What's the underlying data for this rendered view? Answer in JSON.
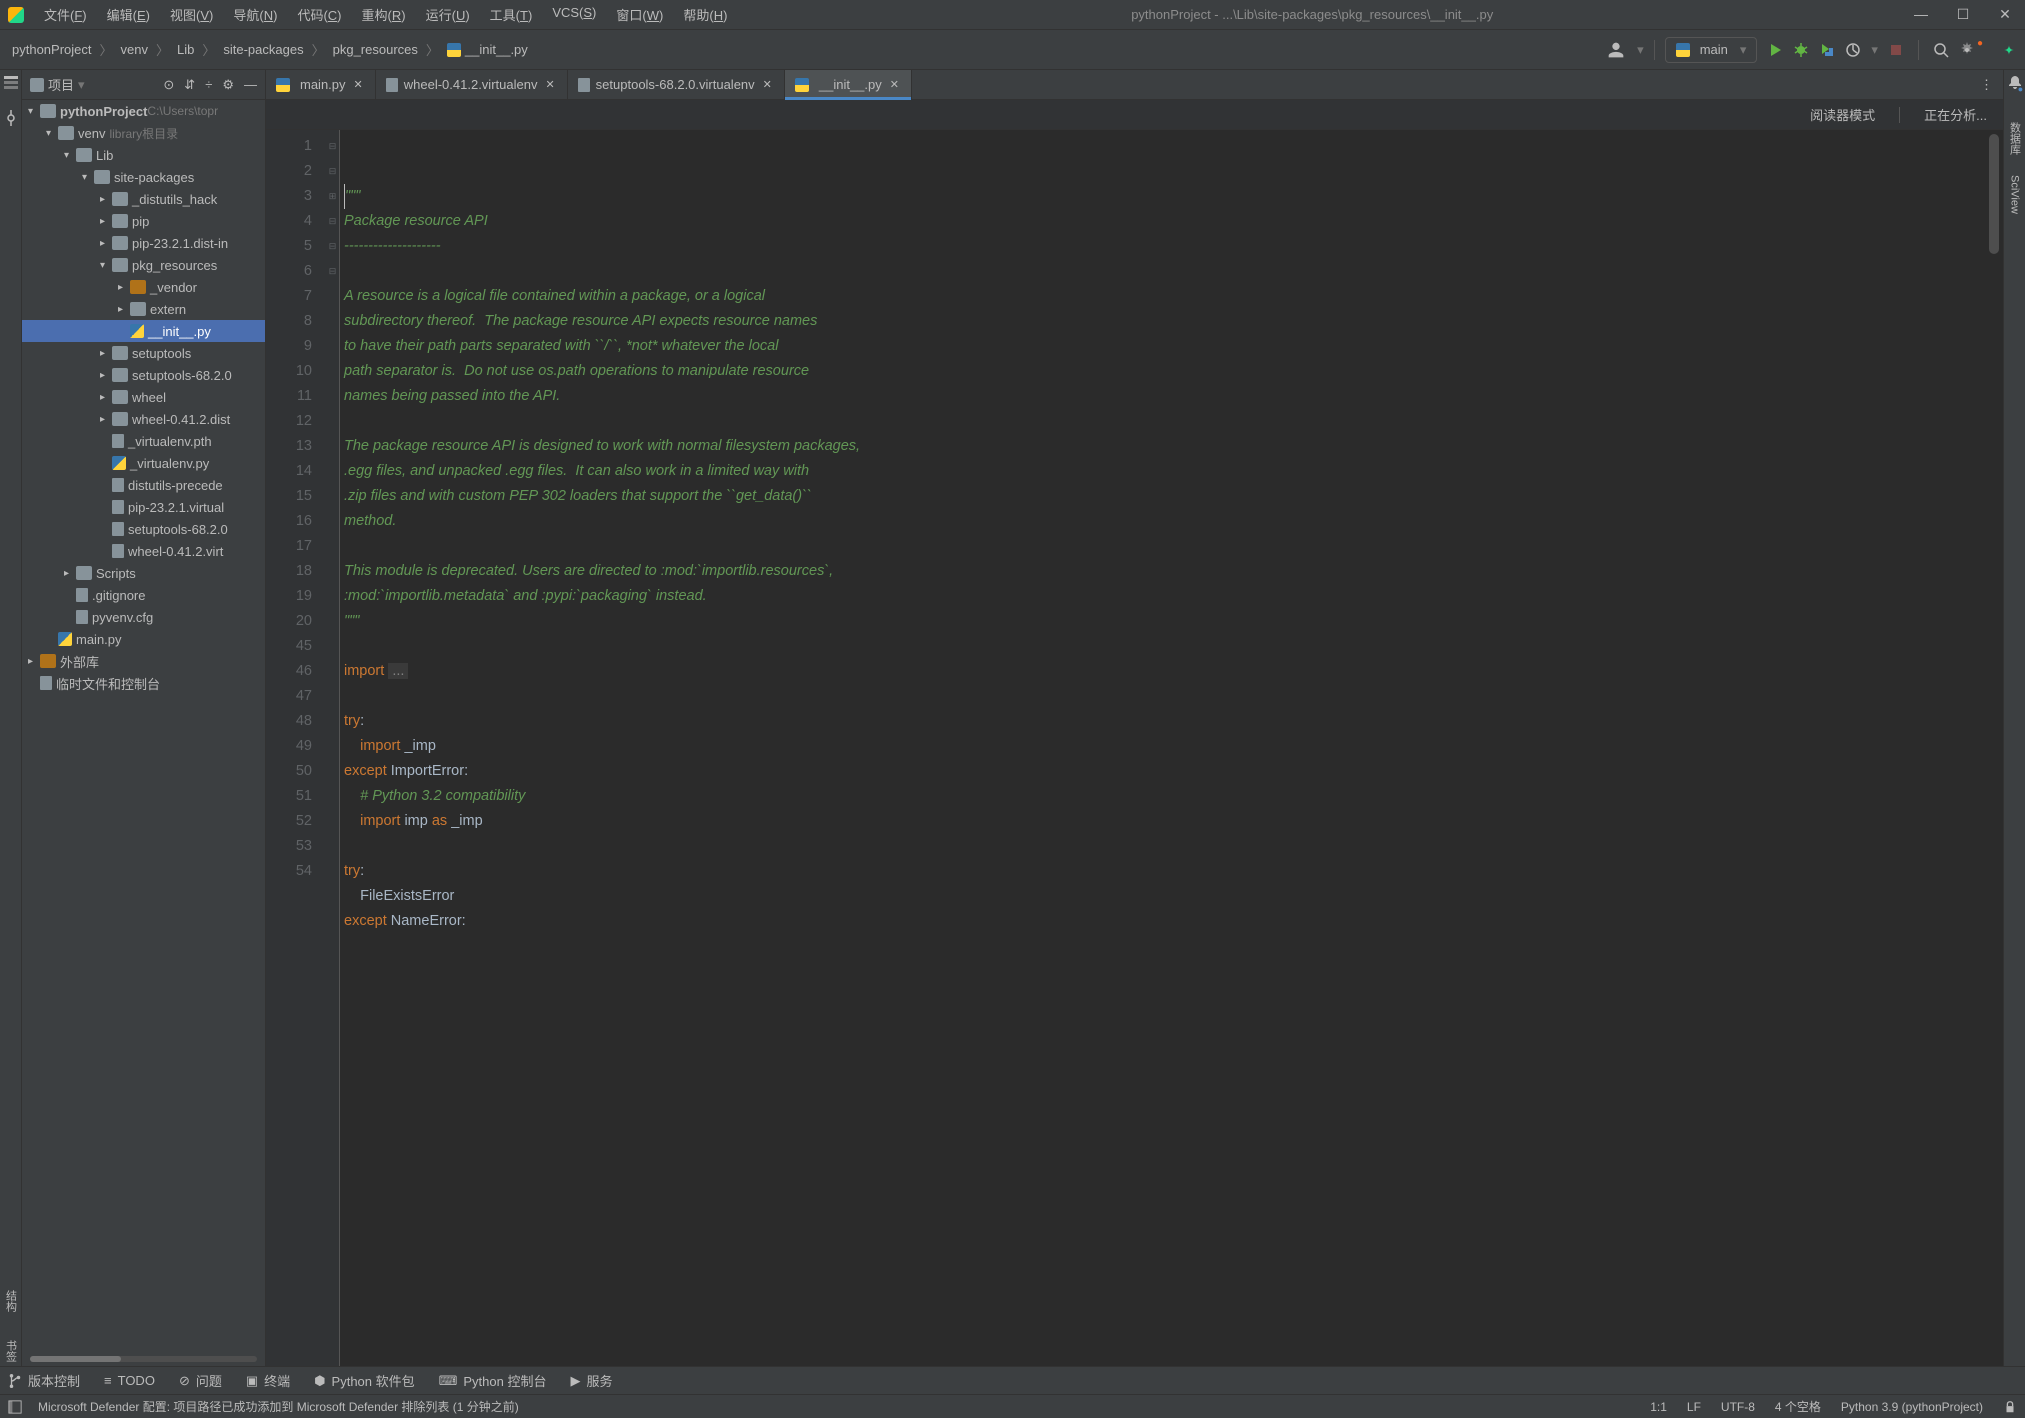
{
  "menubar": {
    "items": [
      {
        "label": "文件",
        "key": "F"
      },
      {
        "label": "编辑",
        "key": "E"
      },
      {
        "label": "视图",
        "key": "V"
      },
      {
        "label": "导航",
        "key": "N"
      },
      {
        "label": "代码",
        "key": "C"
      },
      {
        "label": "重构",
        "key": "R"
      },
      {
        "label": "运行",
        "key": "U"
      },
      {
        "label": "工具",
        "key": "T"
      },
      {
        "label": "VCS",
        "key": "S"
      },
      {
        "label": "窗口",
        "key": "W"
      },
      {
        "label": "帮助",
        "key": "H"
      }
    ]
  },
  "window_title": "pythonProject - ...\\Lib\\site-packages\\pkg_resources\\__init__.py",
  "breadcrumbs": [
    "pythonProject",
    "venv",
    "Lib",
    "site-packages",
    "pkg_resources",
    "__init__.py"
  ],
  "run_config": {
    "name": "main"
  },
  "project_panel": {
    "title": "项目",
    "root": {
      "name": "pythonProject",
      "path": "C:\\Users\\topr"
    },
    "lib_label": "library根目录",
    "tree": {
      "venv": "venv",
      "lib": "Lib",
      "site_packages": "site-packages",
      "distutils_hack": "_distutils_hack",
      "pip": "pip",
      "pip_dist": "pip-23.2.1.dist-in",
      "pkg_resources": "pkg_resources",
      "vendor": "_vendor",
      "extern": "extern",
      "init_py": "__init__.py",
      "setuptools": "setuptools",
      "setuptools_dist": "setuptools-68.2.0",
      "wheel": "wheel",
      "wheel_dist": "wheel-0.41.2.dist",
      "virtualenv_pth": "_virtualenv.pth",
      "virtualenv_py": "_virtualenv.py",
      "distutils_prec": "distutils-precede",
      "pip_virtual": "pip-23.2.1.virtual",
      "setuptools_virt": "setuptools-68.2.0",
      "wheel_virt": "wheel-0.41.2.virt",
      "scripts": "Scripts",
      "gitignore": ".gitignore",
      "pyvenv": "pyvenv.cfg",
      "main_py": "main.py",
      "external": "外部库",
      "scratch": "临时文件和控制台"
    }
  },
  "tabs": [
    {
      "label": "main.py",
      "type": "py"
    },
    {
      "label": "wheel-0.41.2.virtualenv",
      "type": "txt"
    },
    {
      "label": "setuptools-68.2.0.virtualenv",
      "type": "txt"
    },
    {
      "label": "__init__.py",
      "type": "py",
      "active": true
    }
  ],
  "editor_toolbar": {
    "reader_mode": "阅读器模式",
    "analyzing": "正在分析..."
  },
  "code_lines": [
    {
      "n": 1,
      "fold": "-",
      "txt": "\"\"\"",
      "cls": "c-string",
      "cursor": true
    },
    {
      "n": 2,
      "txt": "Package resource API",
      "cls": "c-string"
    },
    {
      "n": 3,
      "txt": "--------------------",
      "cls": "c-string"
    },
    {
      "n": 4,
      "txt": "",
      "cls": "c-string"
    },
    {
      "n": 5,
      "txt": "A resource is a logical file contained within a package, or a logical",
      "cls": "c-string"
    },
    {
      "n": 6,
      "txt": "subdirectory thereof.  The package resource API expects resource names",
      "cls": "c-string"
    },
    {
      "n": 7,
      "txt": "to have their path parts separated with ``/``, *not* whatever the local",
      "cls": "c-string"
    },
    {
      "n": 8,
      "txt": "path separator is.  Do not use os.path operations to manipulate resource",
      "cls": "c-string"
    },
    {
      "n": 9,
      "txt": "names being passed into the API.",
      "cls": "c-string"
    },
    {
      "n": 10,
      "txt": "",
      "cls": "c-string"
    },
    {
      "n": 11,
      "txt": "The package resource API is designed to work with normal filesystem packages,",
      "cls": "c-string"
    },
    {
      "n": 12,
      "txt": ".egg files, and unpacked .egg files.  It can also work in a limited way with",
      "cls": "c-string"
    },
    {
      "n": 13,
      "txt": ".zip files and with custom PEP 302 loaders that support the ``get_data()``",
      "cls": "c-string"
    },
    {
      "n": 14,
      "txt": "method.",
      "cls": "c-string"
    },
    {
      "n": 15,
      "txt": "",
      "cls": "c-string"
    },
    {
      "n": 16,
      "txt": "This module is deprecated. Users are directed to :mod:`importlib.resources`,",
      "cls": "c-string"
    },
    {
      "n": 17,
      "txt": ":mod:`importlib.metadata` and :pypi:`packaging` instead.",
      "cls": "c-string"
    },
    {
      "n": 18,
      "fold": "-",
      "txt": "\"\"\"",
      "cls": "c-string"
    },
    {
      "n": 19,
      "txt": ""
    },
    {
      "n": 20,
      "fold": "+",
      "html": "<span class='c-kw'>import </span><span class='c-folded'>...</span>"
    },
    {
      "n": 45,
      "txt": ""
    },
    {
      "n": 46,
      "html": "<span class='c-kw'>try</span>:"
    },
    {
      "n": 47,
      "html": "    <span class='c-kw'>import</span> _imp"
    },
    {
      "n": 48,
      "fold": "-",
      "html": "<span class='c-kw'>except</span> <span class='c-class'>ImportError</span>:"
    },
    {
      "n": 49,
      "html": "    <span class='c-string'># Python 3.2 compatibility</span>"
    },
    {
      "n": 50,
      "fold": "-",
      "html": "    <span class='c-kw'>import</span> imp <span class='c-kw'>as</span> _imp"
    },
    {
      "n": 51,
      "txt": ""
    },
    {
      "n": 52,
      "html": "<span class='c-kw'>try</span>:"
    },
    {
      "n": 53,
      "html": "    FileExistsError"
    },
    {
      "n": 54,
      "fold": "-",
      "html": "<span class='c-kw'>except</span> <span class='c-class'>NameError</span>:"
    }
  ],
  "bottom_bar": {
    "vcs": "版本控制",
    "todo": "TODO",
    "problems": "问题",
    "terminal": "终端",
    "python_pkg": "Python 软件包",
    "python_console": "Python 控制台",
    "services": "服务"
  },
  "statusbar": {
    "message": "Microsoft Defender 配置: 项目路径已成功添加到 Microsoft Defender 排除列表 (1 分钟之前)",
    "pos": "1:1",
    "line_sep": "LF",
    "encoding": "UTF-8",
    "indent": "4 个空格",
    "interpreter": "Python 3.9 (pythonProject)"
  },
  "right_tools": {
    "notif": "通知",
    "db": "数据库",
    "sciview": "SciView"
  }
}
